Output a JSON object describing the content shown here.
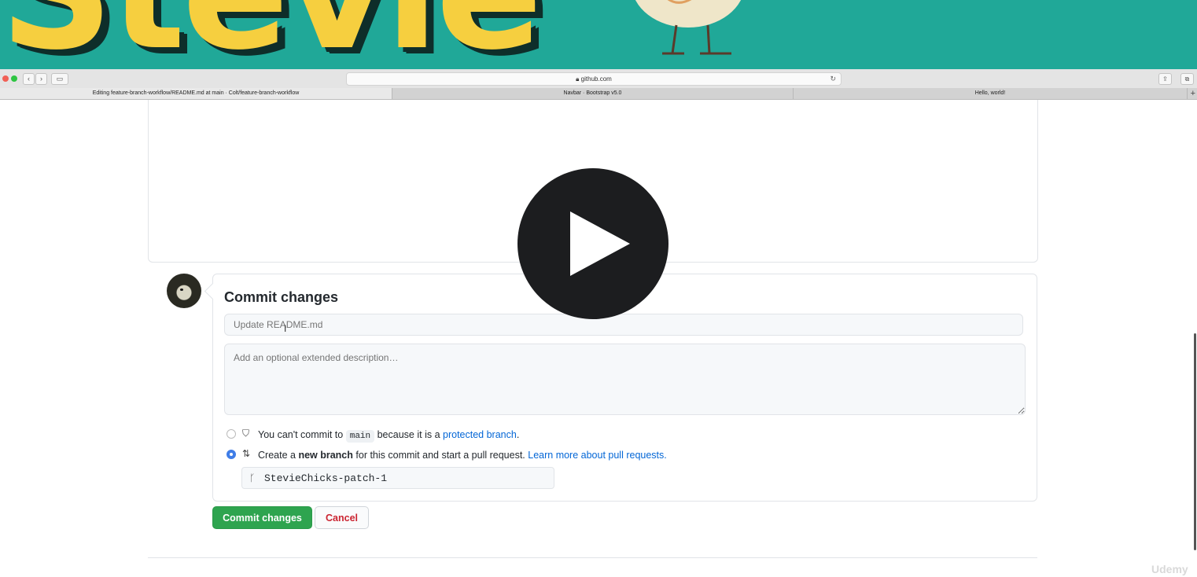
{
  "banner": {
    "text": "Stevie"
  },
  "browser": {
    "url": "github.com",
    "tabs": [
      {
        "label": "Editing feature-branch-workflow/README.md at main · Colt/feature-branch-workflow"
      },
      {
        "label": "Navbar · Bootstrap v5.0"
      },
      {
        "label": "Hello, world!"
      }
    ]
  },
  "commit": {
    "title": "Commit changes",
    "summary_placeholder": "Update README.md",
    "description_placeholder": "Add an optional extended description…",
    "options": {
      "direct": {
        "prefix": "You can't commit to",
        "branch_code": "main",
        "middle": "because it is a",
        "link": "protected branch",
        "suffix": ".",
        "selected": false
      },
      "new_branch": {
        "prefix": "Create a",
        "bold": "new branch",
        "middle": "for this commit and start a pull request.",
        "link": "Learn more about pull requests.",
        "selected": true
      }
    },
    "branch_name": "StevieChicks-patch-1",
    "commit_button": "Commit changes",
    "cancel_button": "Cancel"
  },
  "watermark": "Udemy",
  "colors": {
    "banner_bg": "#20a898",
    "banner_text": "#f6cf3f",
    "commit_green": "#2ea44f",
    "cancel_red": "#cb2431",
    "link_blue": "#0366d6"
  }
}
